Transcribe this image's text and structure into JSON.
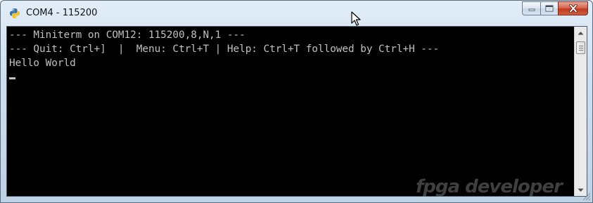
{
  "window": {
    "title": "COM4 - 115200",
    "icon": "python-icon"
  },
  "caption_buttons": {
    "minimize_icon": "minimize-icon",
    "maximize_icon": "maximize-icon",
    "close_icon": "close-icon"
  },
  "console": {
    "lines": [
      "--- Miniterm on COM12: 115200,8,N,1 ---",
      "--- Quit: Ctrl+]  |  Menu: Ctrl+T | Help: Ctrl+T followed by Ctrl+H ---",
      "Hello World"
    ],
    "background_color": "#000000",
    "text_color": "#c0c0c0"
  },
  "watermark": {
    "text": "fpga developer"
  }
}
